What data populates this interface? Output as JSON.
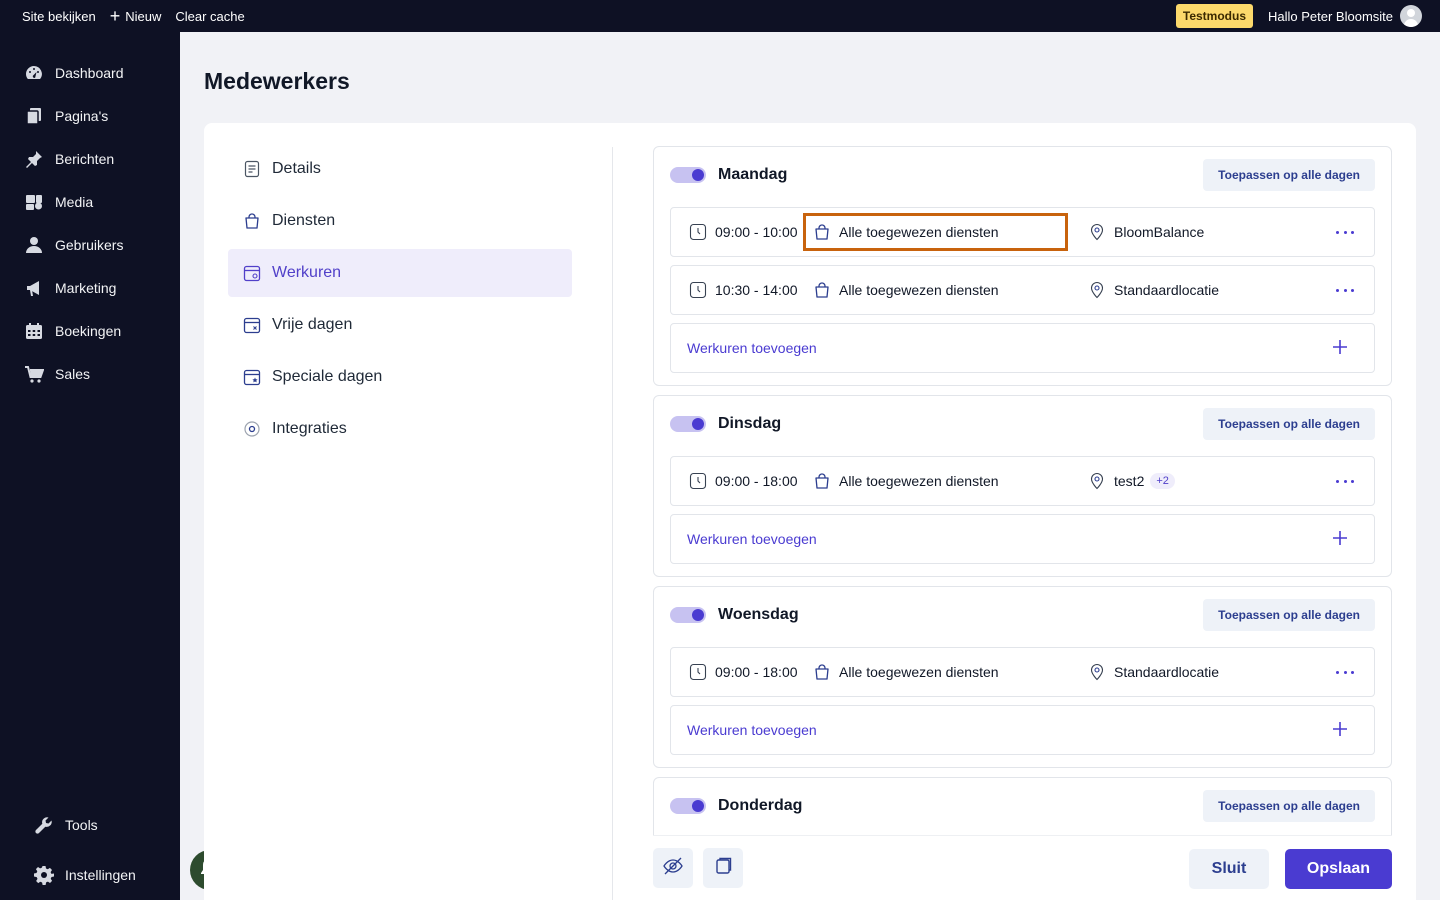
{
  "topbar": {
    "site_label": "Site bekijken",
    "new_label": "Nieuw",
    "cache_label": "Clear cache",
    "testmode_label": "Testmodus",
    "greeting": "Hallo Peter Bloomsite"
  },
  "sidebar": {
    "items": [
      {
        "label": "Dashboard",
        "icon": "dashboard-icon"
      },
      {
        "label": "Pagina's",
        "icon": "pages-icon"
      },
      {
        "label": "Berichten",
        "icon": "pin-icon"
      },
      {
        "label": "Media",
        "icon": "media-icon"
      },
      {
        "label": "Gebruikers",
        "icon": "user-icon"
      },
      {
        "label": "Marketing",
        "icon": "megaphone-icon"
      },
      {
        "label": "Boekingen",
        "icon": "calendar-icon"
      },
      {
        "label": "Sales",
        "icon": "cart-icon"
      }
    ],
    "bottom": [
      {
        "label": "Tools",
        "icon": "wrench-icon"
      },
      {
        "label": "Instellingen",
        "icon": "gear-icon"
      }
    ]
  },
  "page": {
    "title": "Medewerkers"
  },
  "subnav": {
    "items": [
      {
        "label": "Details",
        "active": false
      },
      {
        "label": "Diensten",
        "active": false
      },
      {
        "label": "Werkuren",
        "active": true
      },
      {
        "label": "Vrije dagen",
        "active": false
      },
      {
        "label": "Speciale dagen",
        "active": false
      },
      {
        "label": "Integraties",
        "active": false
      }
    ]
  },
  "apply_label": "Toepassen op alle dagen",
  "add_label": "Werkuren toevoegen",
  "days": {
    "maandag": {
      "name": "Maandag",
      "enabled": true,
      "slots": [
        {
          "time": "09:00 - 10:00",
          "service": "Alle toegewezen diensten",
          "location": "BloomBalance"
        },
        {
          "time": "10:30 - 14:00",
          "service": "Alle toegewezen diensten",
          "location": "Standaardlocatie"
        }
      ]
    },
    "dinsdag": {
      "name": "Dinsdag",
      "enabled": true,
      "slots": [
        {
          "time": "09:00 - 18:00",
          "service": "Alle toegewezen diensten",
          "location": "test2",
          "extra": "+2"
        }
      ]
    },
    "woensdag": {
      "name": "Woensdag",
      "enabled": true,
      "slots": [
        {
          "time": "09:00 - 18:00",
          "service": "Alle toegewezen diensten",
          "location": "Standaardlocatie"
        }
      ]
    },
    "donderdag": {
      "name": "Donderdag",
      "enabled": true
    }
  },
  "footer": {
    "close_label": "Sluit",
    "save_label": "Opslaan"
  },
  "colors": {
    "accent": "#4a3bd1",
    "sidebar_bg": "#0e1124",
    "highlight": "#c8630d",
    "testmode": "#fcd96b"
  }
}
